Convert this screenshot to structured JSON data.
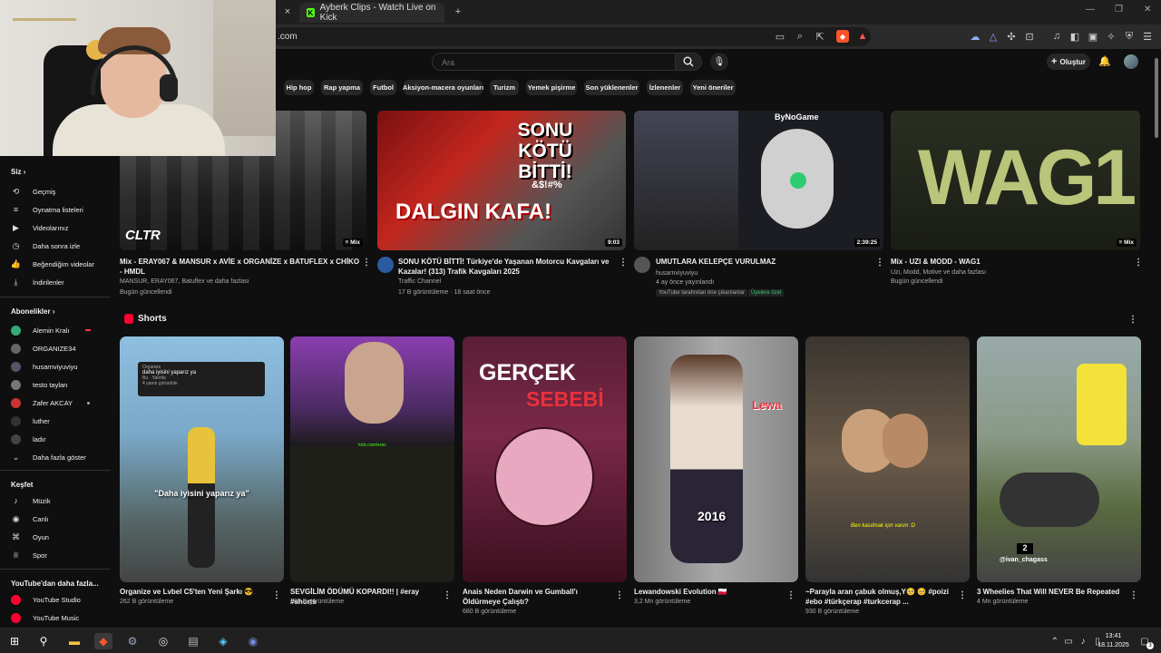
{
  "browser": {
    "tab_title": "Ayberk Clips - Watch Live on Kick",
    "url_suffix": ".com",
    "kick_logo": "K",
    "close_icon": "×",
    "new_tab_icon": "+"
  },
  "header": {
    "search_placeholder": "Ara",
    "create_label": "Oluştur"
  },
  "chips": [
    "Hip hop",
    "Rap yapma",
    "Futbol",
    "Aksiyon-macera oyunları",
    "Turizm",
    "Yemek pişirme",
    "Son yüklenenler",
    "İzlenenler",
    "Yeni öneriler"
  ],
  "sidebar": {
    "you_header": "Siz",
    "you_items": [
      "Geçmiş",
      "Oynatma listeleri",
      "Videolarınız",
      "Daha sonra izle",
      "Beğendiğim videolar",
      "İndirilenler"
    ],
    "subs_header": "Abonelikler",
    "subs": [
      "Alemin Kralı",
      "ORGANIZE34",
      "husarnviyuviyu",
      "testo taylan",
      "Zafer AKCAY",
      "luther",
      "ladır"
    ],
    "show_more": "Daha fazla göster",
    "explore_header": "Keşfet",
    "explore_items": [
      "Müzik",
      "Canlı",
      "Oyun",
      "Spor"
    ],
    "more_header": "YouTube'dan daha fazla...",
    "more_items": [
      "YouTube Studio",
      "YouTube Music"
    ]
  },
  "videos": [
    {
      "title": "Mix - ERAY067 & MANSUR x AVİE x ORGANİZE x BATUFLEX x CHİKO - HMDL",
      "channel": "MANSUR, ERAY067, Batuflex ve daha fazlası",
      "meta": "Bugün güncellendi",
      "thumb_text": "CLTR",
      "mix_label": "Mix",
      "duration": ""
    },
    {
      "title": "SONU KÖTÜ BİTTİ! Türkiye'de Yaşanan Motorcu Kavgaları ve Kazalar! (313) Trafik Kavgaları 2025",
      "channel": "Traffic Channel",
      "meta": "17 B görüntüleme · 18 saat önce",
      "thumb_text_top": "SONU KÖTÜ BİTTİ!",
      "thumb_text_sym": "&$!#%",
      "thumb_text_bottom": "DALGIN KAFA!",
      "duration": "9:03"
    },
    {
      "title": "UMUTLARA KELEPÇE VURULMAZ",
      "channel": "husarnviyuviyu",
      "meta": "4 ay önce yayınlandı",
      "badge1": "YouTube tarafından öne çıkarılanlar",
      "badge2": "Üyelere özel",
      "thumb_text": "ByNoGame",
      "duration": "2:39:25"
    },
    {
      "title": "Mix - UZI & MODD - WAG1",
      "channel": "Uzi, Modd, Motive ve daha fazlası",
      "meta": "Bugün güncellendi",
      "thumb_text": "WAG1",
      "mix_label": "Mix",
      "duration": ""
    }
  ],
  "shorts_header": "Shorts",
  "shorts": [
    {
      "title": "Organize ve Lvbel C5'ten Yeni Şarkı 😎",
      "views": "262 B görüntüleme",
      "overlay": "\"Daha iyisini yaparız ya\"",
      "comment": "daha iyisini yaparız ya",
      "comment_user": "Organize",
      "comment_meta": "Bu · Yanıtla",
      "comment_more": "4 yanıtı görüntüle"
    },
    {
      "title": "SEVGİLİM ÖDÜMÜ KOPARDI!! | #eray #shorts",
      "views": "288 B görüntüleme",
      "overlay": "kick.com/eray"
    },
    {
      "title": "Anais Neden Darwin ve Gumball'ı Öldürmeye Çalıştı?",
      "views": "680 B görüntüleme",
      "overlay1": "GERÇEK",
      "overlay2": "SEBEBİ"
    },
    {
      "title": "Lewandowski Evolution 🇵🇱",
      "views": "3,2 Mn görüntüleme",
      "overlay1": "Lewa",
      "overlay2": "2016"
    },
    {
      "title": "~Parayla aran çabuk olmuş,Y🥺 🥺 #poizi #ebo #türkçerap #turkcerap ...",
      "views": "930 B görüntüleme",
      "overlay": "Ben kasılmak için varım :D"
    },
    {
      "title": "3 Wheelies That Will NEVER Be Repeated",
      "views": "4 Mn görüntüleme",
      "overlay_num": "2",
      "overlay_user": "@ivan_chagass"
    }
  ],
  "taskbar": {
    "time": "13:41",
    "date": "18.11.2025",
    "notif": "3"
  },
  "colors": {
    "yt_red": "#ff0033",
    "kick_green": "#53fc18",
    "bg": "#0f0f0f",
    "chip_bg": "#272727"
  }
}
